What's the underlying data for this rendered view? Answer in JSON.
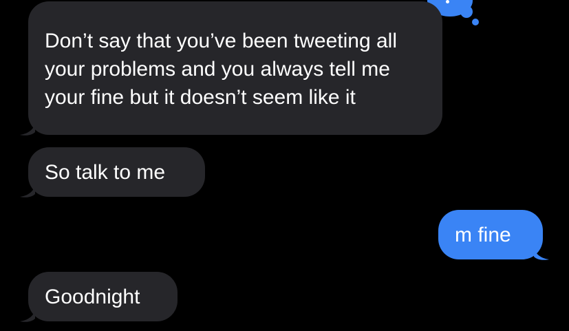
{
  "messages": [
    {
      "direction": "incoming",
      "text": "Don’t say that you’ve been tweeting all your problems and you always tell me your fine but it doesn’t seem like it"
    },
    {
      "direction": "incoming",
      "text": "So talk to me"
    },
    {
      "direction": "outgoing",
      "text": "m fine"
    },
    {
      "direction": "incoming",
      "text": "Goodnight"
    }
  ],
  "colors": {
    "background": "#000000",
    "incoming_bubble": "#26262a",
    "outgoing_bubble": "#3a84f5",
    "text": "#ffffff"
  },
  "icons": {
    "typing_indicator": "typing-indicator-icon"
  }
}
